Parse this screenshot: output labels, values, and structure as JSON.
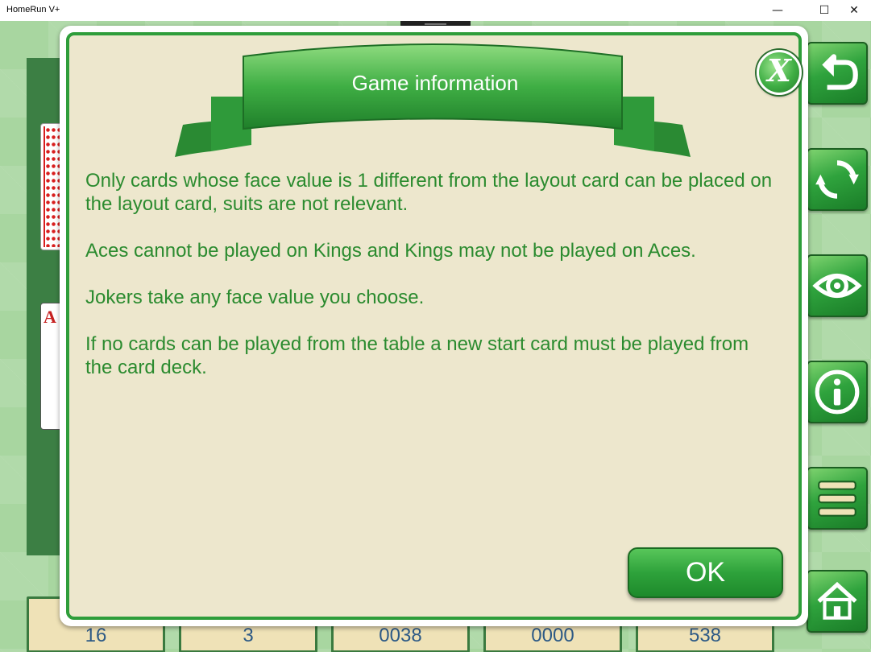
{
  "window": {
    "title": "HomeRun V+",
    "minimize_glyph": "—",
    "maximize_glyph": "☐",
    "close_glyph": "✕"
  },
  "board": {
    "ace_rank": "A"
  },
  "scores": [
    "16",
    "3",
    "0038",
    "0000",
    "538"
  ],
  "sidebar": {
    "buttons": [
      "undo-icon",
      "refresh-icon",
      "eye-icon",
      "info-icon",
      "menu-icon",
      "home-icon"
    ]
  },
  "dialog": {
    "title": "Game information",
    "close_glyph": "X",
    "paragraphs": [
      "Only cards whose face value is 1 different from the layout card can be placed on the layout card, suits are not relevant.",
      "Aces cannot be played on Kings and Kings may not be played on Aces.",
      "Jokers take any face value you choose.",
      "If no cards can be played from the table a new start card must be played from the card deck."
    ],
    "ok_label": "OK"
  },
  "colors": {
    "accent_green": "#2e9d3a",
    "text_green": "#2b8b2f",
    "dialog_bg": "#ede7cd",
    "score_text": "#2d5a86"
  }
}
